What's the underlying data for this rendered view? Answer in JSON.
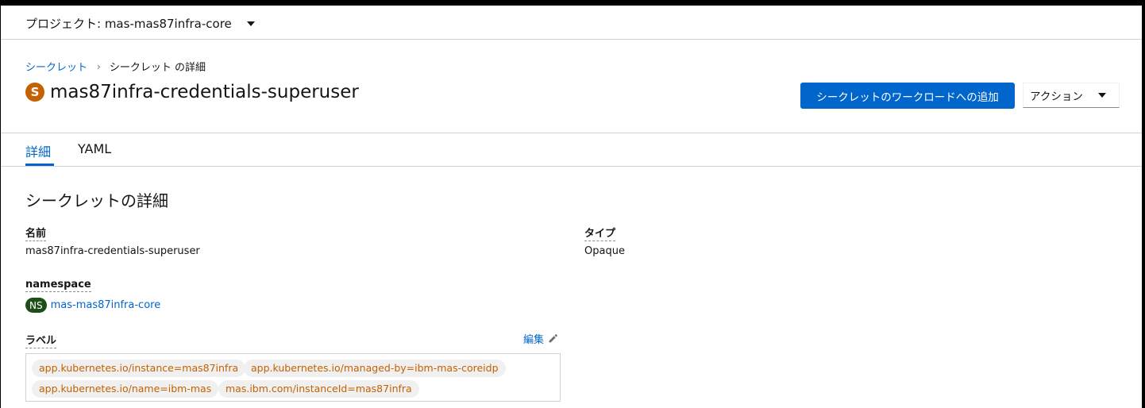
{
  "project_bar": {
    "label": "プロジェクト: mas-mas87infra-core"
  },
  "breadcrumb": {
    "parent": "シークレット",
    "current": "シークレット の詳細"
  },
  "resource": {
    "badge": "S",
    "name": "mas87infra-credentials-superuser"
  },
  "actions": {
    "add_to_workload": "シークレットのワークロードへの追加",
    "actions_menu": "アクション"
  },
  "tabs": [
    {
      "label": "詳細",
      "active": true
    },
    {
      "label": "YAML",
      "active": false
    }
  ],
  "section": {
    "title": "シークレットの詳細"
  },
  "details": {
    "name_label": "名前",
    "name_value": "mas87infra-credentials-superuser",
    "type_label": "タイプ",
    "type_value": "Opaque",
    "namespace_label": "namespace",
    "namespace_badge": "NS",
    "namespace_value": "mas-mas87infra-core",
    "labels_label": "ラベル",
    "edit_label": "編集"
  },
  "labels": [
    "app.kubernetes.io/instance=mas87infra",
    "app.kubernetes.io/managed-by=ibm-mas-coreidp",
    "app.kubernetes.io/name=ibm-mas",
    "mas.ibm.com/instanceId=mas87infra"
  ],
  "colors": {
    "primary": "#0066cc",
    "secret_badge": "#c46100",
    "namespace_badge": "#1e4f18",
    "label_text": "#c46100"
  }
}
